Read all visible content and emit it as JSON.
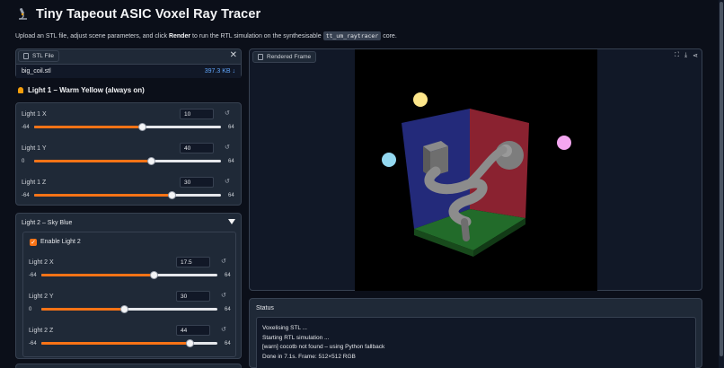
{
  "app": {
    "title": "Tiny Tapeout ASIC Voxel Ray Tracer",
    "subtitle_pre": "Upload an STL file, adjust scene parameters, and click ",
    "subtitle_bold": "Render",
    "subtitle_mid": " to run the RTL simulation on the synthesisable ",
    "subtitle_code": "tt_um_raytracer",
    "subtitle_post": " core."
  },
  "stl": {
    "label": "STL File",
    "filename": "big_coil.stl",
    "size": "397.3 KB ↓"
  },
  "light1": {
    "title": "Light 1 – Warm Yellow (always on)",
    "sliders": [
      {
        "name": "Light 1 X",
        "value": "10",
        "min": "-64",
        "max": "64",
        "fraction": 0.578
      },
      {
        "name": "Light 1 Y",
        "value": "40",
        "min": "0",
        "max": "64",
        "fraction": 0.625
      },
      {
        "name": "Light 1 Z",
        "value": "30",
        "min": "-64",
        "max": "64",
        "fraction": 0.734
      }
    ]
  },
  "light2": {
    "title": "Light 2 – Sky Blue",
    "enable_label": "Enable Light 2",
    "sliders": [
      {
        "name": "Light 2 X",
        "value": "17.5",
        "min": "-64",
        "max": "64",
        "fraction": 0.637
      },
      {
        "name": "Light 2 Y",
        "value": "30",
        "min": "0",
        "max": "64",
        "fraction": 0.469
      },
      {
        "name": "Light 2 Z",
        "value": "44",
        "min": "-64",
        "max": "64",
        "fraction": 0.844
      }
    ]
  },
  "frame": {
    "label": "Rendered Frame"
  },
  "status": {
    "title": "Status",
    "lines": [
      "Voxelising STL ...",
      "Starting RTL simulation ...",
      "[warn] cocotb not found – using Python fallback",
      "Done in 7.1s. Frame: 512×512 RGB"
    ]
  },
  "icons": {
    "header": "microscope-icon",
    "file": "file-icon",
    "image": "image-icon",
    "fullscreen": "fullscreen-icon",
    "download": "download-icon",
    "share": "share-icon",
    "reset": "reset-icon"
  },
  "colors": {
    "accent": "#f97316",
    "background": "#0b0f19",
    "panel": "#1f2937",
    "light1": "#fde68a",
    "light2": "#93d8f0",
    "light3": "#f4a6f0"
  }
}
